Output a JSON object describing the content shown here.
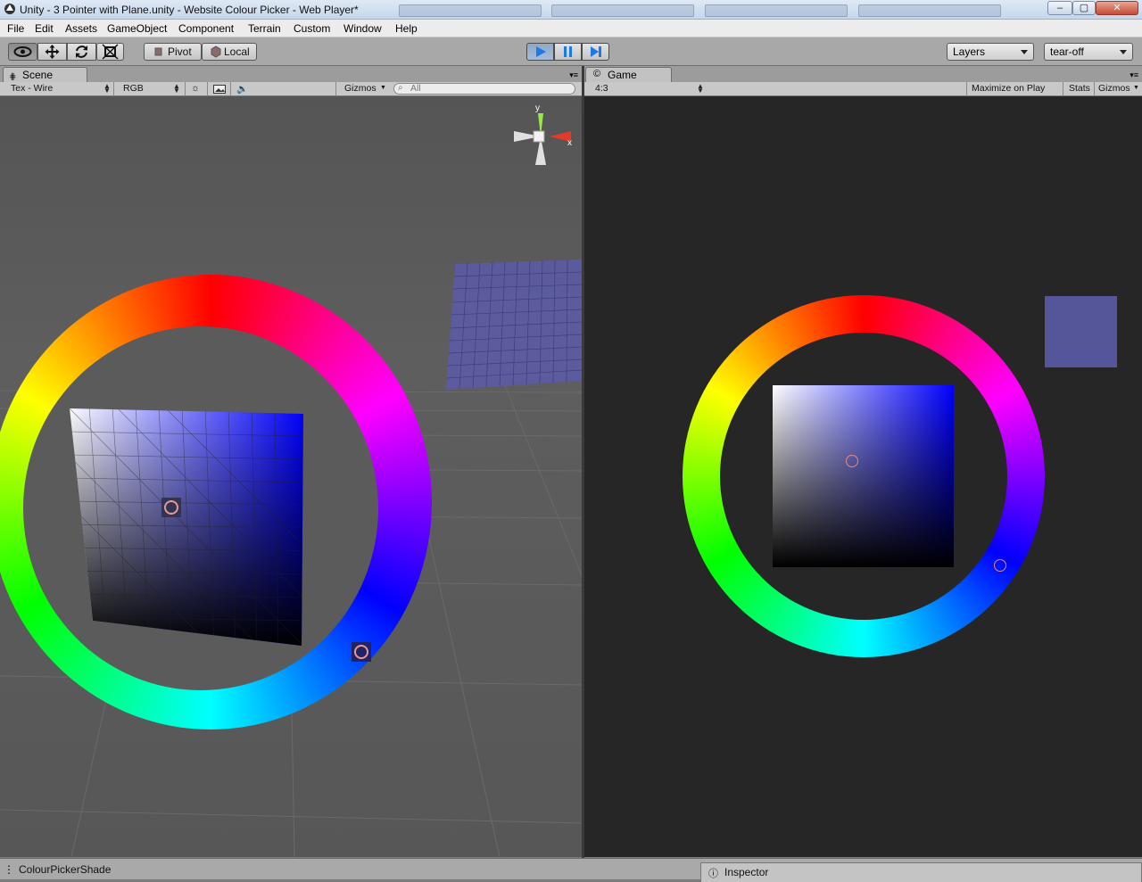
{
  "window": {
    "title": "Unity - 3 Pointer with Plane.unity - Website Colour Picker - Web Player*",
    "minimize": "–",
    "maximize": "▢",
    "close": "✕"
  },
  "menu": [
    "File",
    "Edit",
    "Assets",
    "GameObject",
    "Component",
    "Terrain",
    "Custom",
    "Window",
    "Help"
  ],
  "toolbar": {
    "pivot_label": "Pivot",
    "local_label": "Local",
    "layers_label": "Layers",
    "layout_label": "tear-off"
  },
  "scene": {
    "tab_label": "Scene",
    "render_mode": "Tex - Wire",
    "color_mode": "RGB",
    "gizmos_label": "Gizmos",
    "search_placeholder": "All",
    "axis_y": "y",
    "axis_x": "x"
  },
  "game": {
    "tab_label": "Game",
    "aspect": "4:3",
    "maximize_label": "Maximize on Play",
    "stats_label": "Stats",
    "gizmos_label": "Gizmos",
    "picked_color": "#55559a"
  },
  "status": {
    "message": "ColourPickerShade",
    "inspector_label": "Inspector"
  },
  "colors": {
    "scene_bg": "#5a5a5a",
    "game_bg": "#262626",
    "play_active": "#1e78e6"
  },
  "icons": [
    "unity-logo-icon",
    "eye-icon",
    "move-icon",
    "rotate-icon",
    "scale-icon",
    "play-icon",
    "pause-icon",
    "step-icon",
    "scene-orientation-gizmo",
    "game-icon",
    "sun-icon",
    "image-icon",
    "audio-icon",
    "search-icon"
  ]
}
